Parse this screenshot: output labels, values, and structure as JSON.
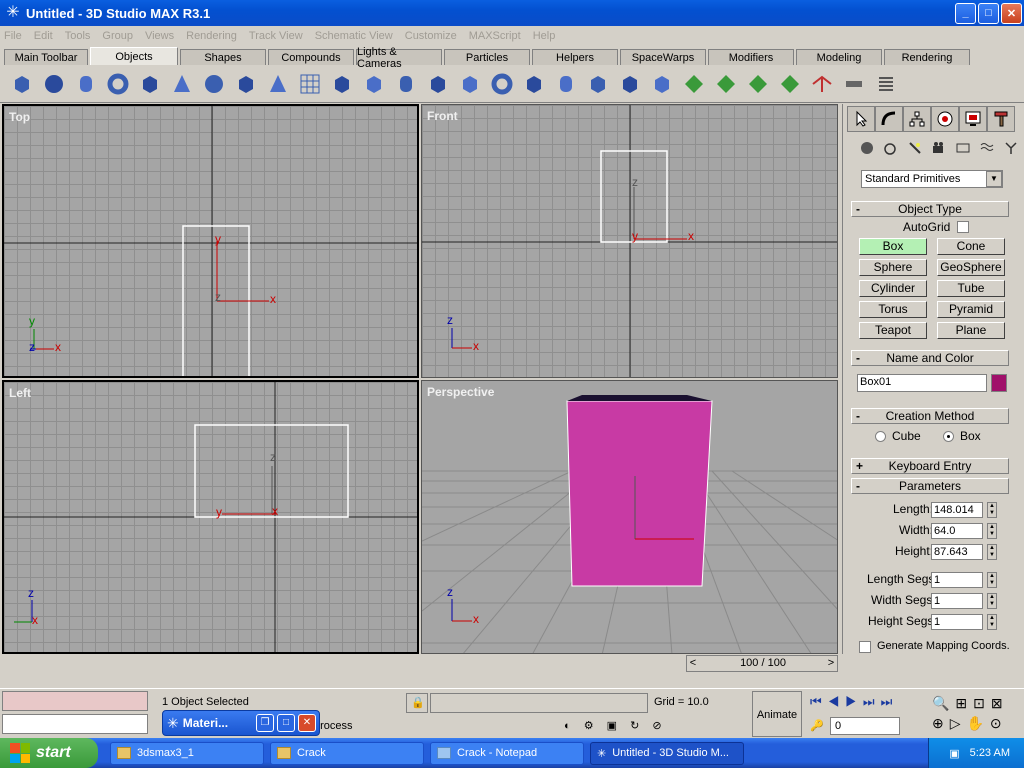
{
  "window": {
    "title": "Untitled - 3D Studio MAX R3.1",
    "minimize": "_",
    "maximize": "□",
    "close": "✕"
  },
  "menu": [
    "File",
    "Edit",
    "Tools",
    "Group",
    "Views",
    "Rendering",
    "Track View",
    "Schematic View",
    "Customize",
    "MAXScript",
    "Help"
  ],
  "tabs": [
    {
      "label": "Main Toolbar",
      "w": 84
    },
    {
      "label": "Objects",
      "w": 88,
      "active": true
    },
    {
      "label": "Shapes",
      "w": 86
    },
    {
      "label": "Compounds",
      "w": 86
    },
    {
      "label": "Lights & Cameras",
      "w": 86
    },
    {
      "label": "Particles",
      "w": 86
    },
    {
      "label": "Helpers",
      "w": 86
    },
    {
      "label": "SpaceWarps",
      "w": 86
    },
    {
      "label": "Modifiers",
      "w": 86
    },
    {
      "label": "Modeling",
      "w": 86
    },
    {
      "label": "Rendering",
      "w": 86
    }
  ],
  "toolbar_icons": [
    "box-icon",
    "sphere-icon",
    "cylinder-icon",
    "torus-icon",
    "teapot-icon",
    "cone-icon",
    "geosphere-icon",
    "tube-icon",
    "pyramid-icon",
    "plane-icon",
    "hedra-icon",
    "chamfer-box-icon",
    "oil-tank-icon",
    "spindle-icon",
    "gengon-icon",
    "ring-wave-icon",
    "hose-icon",
    "capsule-icon",
    "l-ext-icon",
    "c-ext-icon",
    "prism-icon",
    "grid-icon",
    "grid2-icon",
    "nurbs-icon",
    "nurbs2-icon",
    "connect-icon",
    "bone-icon",
    "spring-icon"
  ],
  "viewports": {
    "top": "Top",
    "front": "Front",
    "left": "Left",
    "perspective": "Perspective"
  },
  "axes": {
    "x": "x",
    "y": "y",
    "z": "z"
  },
  "cmd": {
    "dropdown": "Standard Primitives",
    "object_type": "Object Type",
    "autogrid": "AutoGrid",
    "buttons": [
      "Box",
      "Cone",
      "Sphere",
      "GeoSphere",
      "Cylinder",
      "Tube",
      "Torus",
      "Pyramid",
      "Teapot",
      "Plane"
    ],
    "name_color": "Name and Color",
    "name_value": "Box01",
    "object_color": "#a0106a",
    "creation_method": "Creation Method",
    "cube": "Cube",
    "box": "Box",
    "keyboard_entry": "Keyboard Entry",
    "parameters": "Parameters",
    "length_label": "Length:",
    "length": "148.014",
    "width_label": "Width:",
    "width": "64.0",
    "height_label": "Height:",
    "height": "87.643",
    "lsegs_label": "Length Segs:",
    "lsegs": "1",
    "wsegs_label": "Width Segs:",
    "wsegs": "1",
    "hsegs_label": "Height Segs:",
    "hsegs": "1",
    "gen_mapping": "Generate Mapping Coords.",
    "plus": "+",
    "minus": "-"
  },
  "timeslider": {
    "value": "100 / 100",
    "prev": "<",
    "next": ">"
  },
  "status": {
    "selected": "1 Object Selected",
    "grid": "Grid = 10.0",
    "animate": "Animate",
    "frame": "0",
    "process": "process"
  },
  "materi": {
    "title": "Materi..."
  },
  "taskbar": {
    "start": "start",
    "tasks": [
      {
        "label": "3dsmax3_1"
      },
      {
        "label": "Crack"
      },
      {
        "label": "Crack - Notepad"
      },
      {
        "label": "Untitled - 3D Studio M...",
        "active": true
      }
    ],
    "clock": "5:23 AM"
  }
}
